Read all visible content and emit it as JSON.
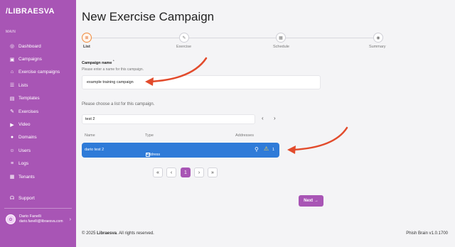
{
  "sidebar": {
    "logo": "/LIBRAESVA",
    "section_label": "MAIN",
    "items": [
      {
        "label": "Dashboard",
        "icon": "dashboard-icon"
      },
      {
        "label": "Campaigns",
        "icon": "calendar-icon"
      },
      {
        "label": "Exercise campaigns",
        "icon": "graduation-cap-icon"
      },
      {
        "label": "Lists",
        "icon": "list-icon"
      },
      {
        "label": "Templates",
        "icon": "template-icon"
      },
      {
        "label": "Exercises",
        "icon": "wand-icon"
      },
      {
        "label": "Video",
        "icon": "video-icon"
      },
      {
        "label": "Domains",
        "icon": "globe-icon"
      },
      {
        "label": "Users",
        "icon": "users-icon"
      },
      {
        "label": "Logs",
        "icon": "logs-icon"
      },
      {
        "label": "Tenants",
        "icon": "building-icon"
      }
    ],
    "support": "Support",
    "user": {
      "name": "Dario Fanelli",
      "email": "dario.fanelli@libraesva.com"
    }
  },
  "main": {
    "title": "New Exercise Campaign",
    "steps": [
      "List",
      "Exercise",
      "Schedule",
      "Summary"
    ],
    "active_step": 0,
    "name_label": "Campaign name",
    "name_required": "*",
    "name_help": "Please enter a name for this campaign.",
    "name_value": "example training campaign",
    "list_help": "Please choose a list for this campaign.",
    "search_value": "test 2",
    "table": {
      "headers": [
        "Name",
        "Type",
        "Addresses"
      ],
      "rows": [
        {
          "name": "dario test 2",
          "type": "Address",
          "addresses": "1",
          "selected": true
        }
      ]
    },
    "pagination": {
      "first": "«",
      "prev": "‹",
      "current": "1",
      "next": "›",
      "last": "»"
    },
    "search_prev": "‹",
    "search_next": "›",
    "next_button": "Next →"
  },
  "footer": {
    "copyright_prefix": "© 2025 ",
    "brand": "Libraesva",
    "copyright_suffix": ". All rights reserved.",
    "version": "Phish Brain v1.0.1700"
  },
  "colors": {
    "sidebar": "#a855b5",
    "accent": "#a855b5",
    "selected_row": "#2f7bd8",
    "annotation_arrow": "#e24b2c"
  }
}
